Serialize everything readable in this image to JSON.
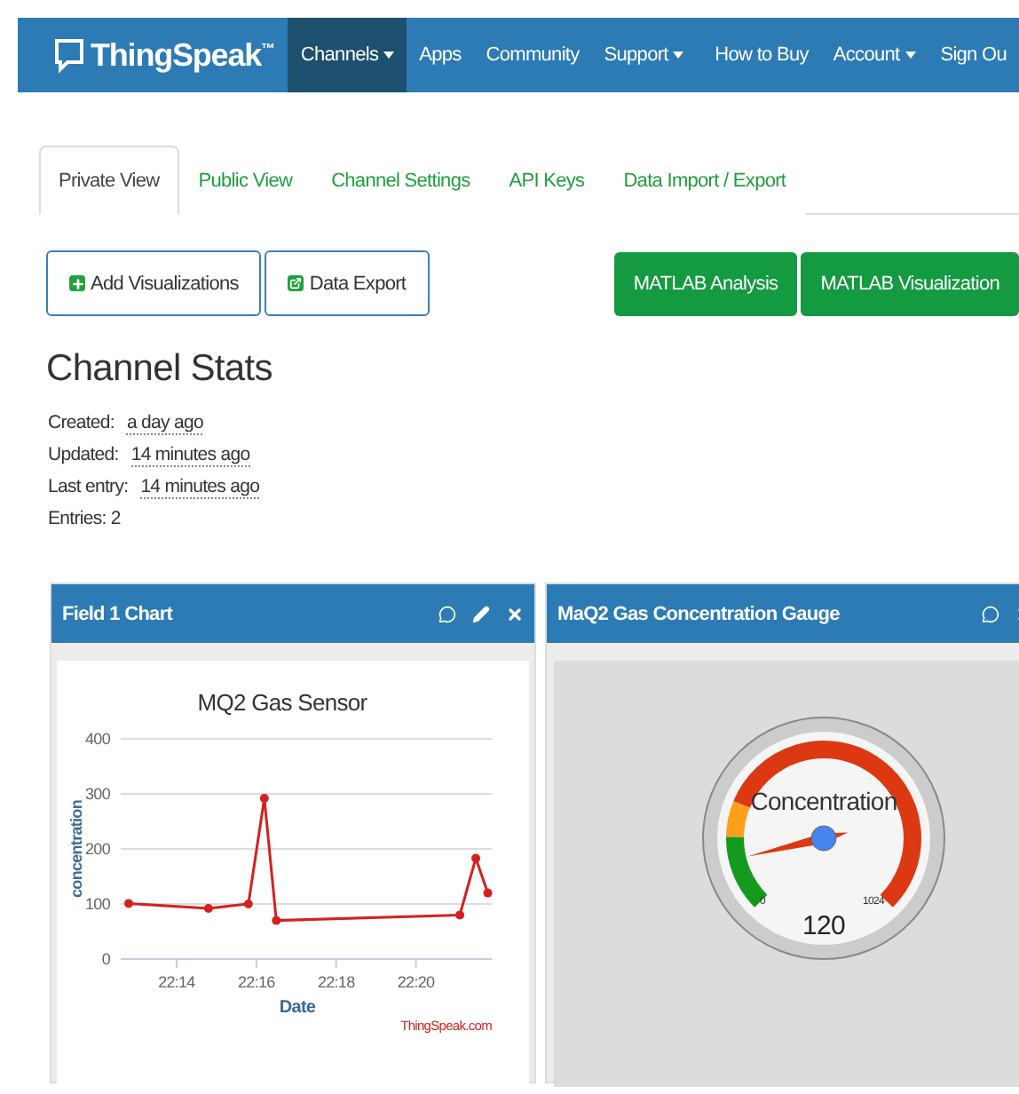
{
  "navbar": {
    "brand": "ThingSpeak",
    "trademark": "™",
    "items": [
      {
        "label": "Channels",
        "dropdown": true,
        "selected": true
      },
      {
        "label": "Apps",
        "dropdown": false,
        "selected": false
      },
      {
        "label": "Community",
        "dropdown": false,
        "selected": false
      },
      {
        "label": "Support",
        "dropdown": true,
        "selected": false
      }
    ],
    "right_items": [
      {
        "label": "How to Buy",
        "dropdown": false
      },
      {
        "label": "Account",
        "dropdown": true
      },
      {
        "label": "Sign Ou",
        "dropdown": false
      }
    ]
  },
  "tabs": [
    {
      "label": "Private View",
      "selected": true
    },
    {
      "label": "Public View",
      "selected": false
    },
    {
      "label": "Channel Settings",
      "selected": false
    },
    {
      "label": "API Keys",
      "selected": false
    },
    {
      "label": "Data Import / Export",
      "selected": false
    }
  ],
  "actions": [
    "Add Visualizations",
    "Data Export"
  ],
  "matlab_buttons": [
    "MATLAB Analysis",
    "MATLAB Visualization"
  ],
  "channel_stats": {
    "title": "Channel Stats",
    "rows": [
      {
        "label": "Created:",
        "value": "a day ago"
      },
      {
        "label": "Updated:",
        "value": "14 minutes ago"
      },
      {
        "label": "Last entry:",
        "value": "14 minutes ago"
      },
      {
        "label": "Entries: 2"
      }
    ]
  },
  "chart_panel": {
    "title": "Field 1 Chart",
    "editable": true,
    "chart_data": {
      "type": "line",
      "grid": true,
      "title": "MQ2 Gas Sensor",
      "xlabel": "Date",
      "ylabel": "concentration",
      "x": [
        1332.8,
        1334.8,
        1335.8,
        1336.2,
        1336.5,
        1341.1,
        1341.5,
        1341.8
      ],
      "series": [
        {
          "marker": "circle",
          "color": "#d62020",
          "values": [
            101,
            92,
            100,
            292,
            70,
            80,
            183,
            120
          ]
        }
      ],
      "xlim": [
        1332.6,
        1341.9
      ],
      "ylim": [
        0,
        400
      ],
      "xticks": [
        {
          "value": 1334,
          "label": "22:14"
        },
        {
          "value": 1336,
          "label": "22:16"
        },
        {
          "value": 1338,
          "label": "22:18"
        },
        {
          "value": 1340,
          "label": "22:20"
        }
      ],
      "yticks": [
        0,
        100,
        200,
        300,
        400
      ]
    },
    "credit": "ThingSpeak.com"
  },
  "gauge_panel": {
    "title": "MaQ2 Gas Concentration Gauge",
    "editable": false,
    "gauge": {
      "label": "Concentration",
      "min": "0",
      "max": "1024",
      "reading": "120"
    }
  }
}
